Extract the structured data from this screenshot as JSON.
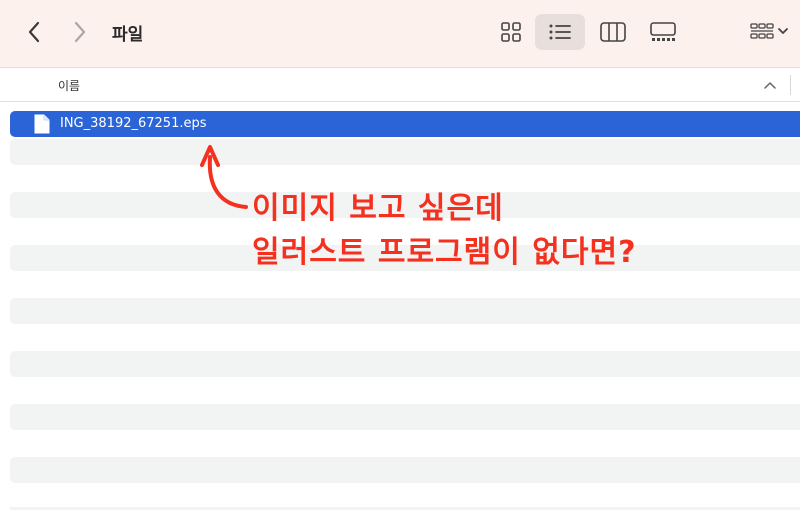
{
  "toolbar": {
    "title": "파일",
    "back_icon": "chevron-left-icon",
    "forward_icon": "chevron-right-icon",
    "view_modes": [
      "icon-view",
      "list-view",
      "column-view",
      "gallery-view"
    ],
    "active_view": "list-view",
    "group_icon": "group-by-icon"
  },
  "list_header": {
    "name_column": "이름",
    "sort_icon": "chevron-up-icon"
  },
  "files": [
    {
      "name": "ING_38192_67251.eps",
      "selected": true,
      "icon": "document-icon",
      "edge_text": "5"
    }
  ],
  "annotation": {
    "line1": "이미지 보고 싶은데",
    "line2": "일러스트 프로그램이 없다면?",
    "color": "#f4301f"
  },
  "colors": {
    "toolbar_bg": "#fdf1ee",
    "selection": "#2a64d6",
    "stripe": "#f2f3f3"
  }
}
